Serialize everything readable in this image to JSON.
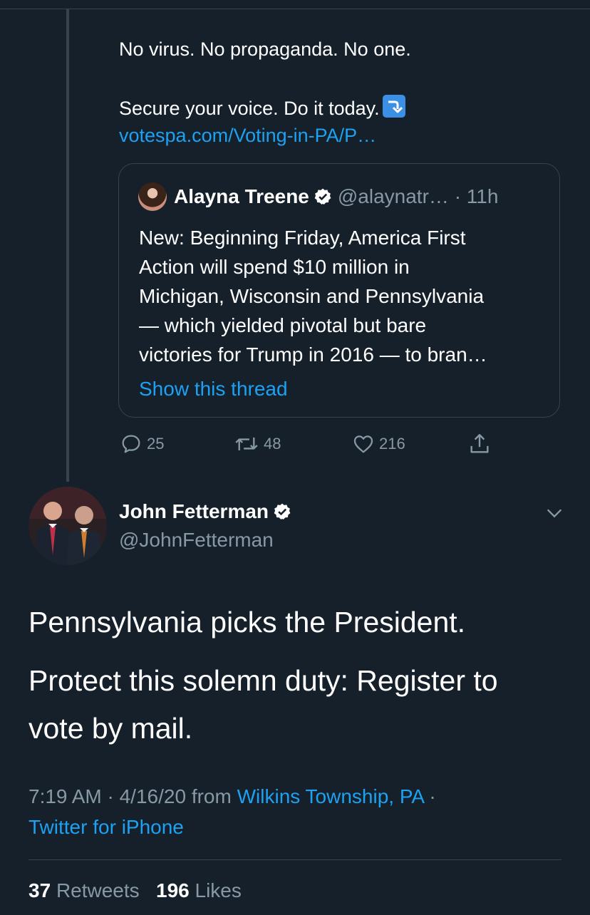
{
  "parent_tweet": {
    "line1": "No virus. No propaganda. No one.",
    "line2": "Secure your voice. Do it today.",
    "link": "votespa.com/Voting-in-PA/P…",
    "quoted": {
      "name": "Alayna Treene",
      "handle": "@alaynatr…",
      "time": "· 11h",
      "lines": [
        "New: Beginning Friday, America First",
        "Action will spend $10 million in",
        "Michigan, Wisconsin and Pennsylvania",
        "— which yielded pivotal but bare",
        "victories for Trump in 2016 — to bran…"
      ],
      "show_thread": "Show this thread"
    },
    "actions": {
      "replies": "25",
      "retweets": "48",
      "likes": "216"
    }
  },
  "main_tweet": {
    "name": "John Fetterman",
    "handle": "@JohnFetterman",
    "text1": "Pennsylvania picks the President.",
    "text2": "Protect this solemn duty:  Register to",
    "text3": "vote by mail.",
    "time": "7:19 AM · 4/16/20",
    "from_label": "from",
    "location": "Wilkins Township, PA",
    "sep": "·",
    "source": "Twitter for iPhone",
    "retweet_count": "37",
    "retweet_label": "Retweets",
    "like_count": "196",
    "like_label": "Likes"
  },
  "colors": {
    "background": "#15202b",
    "accent": "#1da1f2",
    "muted": "#8899a6",
    "border": "#38444d"
  },
  "icons": [
    "reply-icon",
    "retweet-icon",
    "like-icon",
    "share-icon",
    "verified-icon",
    "chevron-down-icon",
    "arrow-emoji-icon"
  ]
}
